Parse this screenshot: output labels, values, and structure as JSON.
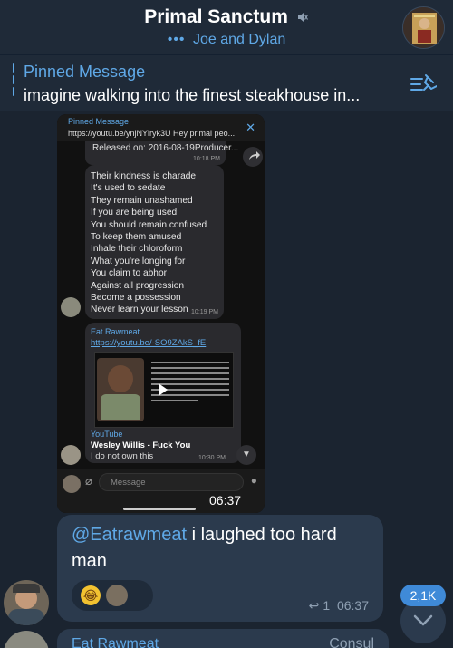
{
  "header": {
    "title": "Primal Sanctum",
    "subtitle": "Joe and Dylan",
    "typing_indicator": "•••"
  },
  "pinned": {
    "title": "Pinned Message",
    "text": "imagine walking into the finest steakhouse in..."
  },
  "screenshot": {
    "pinned_title": "Pinned Message",
    "pinned_text": "https://youtu.be/ynjNYlryk3U Hey primal peo...",
    "released_text": "Released on: 2016-08-19Producer...",
    "released_time": "10:18 PM",
    "lyrics": [
      "Their kindness is charade",
      "It's used to sedate",
      "They remain unashamed",
      "If you are being used",
      "You should remain confused",
      "To keep them amused",
      "Inhale their chloroform",
      "What you're longing for",
      "You claim to abhor",
      "Against all progression",
      "Become a possession",
      "Never learn your lesson"
    ],
    "lyrics_time": "10:19 PM",
    "sender_name": "Eat Rawmeat",
    "link": "https://youtu.be/-SO9ZAkS_fE",
    "preview_site": "YouTube",
    "preview_title": "Wesley Willis  -  Fuck You",
    "preview_desc": "I do not own this",
    "preview_time": "10:30 PM",
    "input_placeholder": "Message",
    "clock": "06:37"
  },
  "message": {
    "mention": "@Eatrawmeat",
    "text": " i laughed too hard man",
    "reaction_emoji": "😂",
    "reply_count": "1",
    "time": "06:37"
  },
  "unread_badge": "2,1K",
  "next_message": {
    "sender": "Eat Rawmeat",
    "partial": "Consul"
  },
  "colors": {
    "accent": "#5fa8e6",
    "bubble": "#2b3a4d",
    "background": "#1b2430",
    "badge": "#3f8ad8"
  }
}
